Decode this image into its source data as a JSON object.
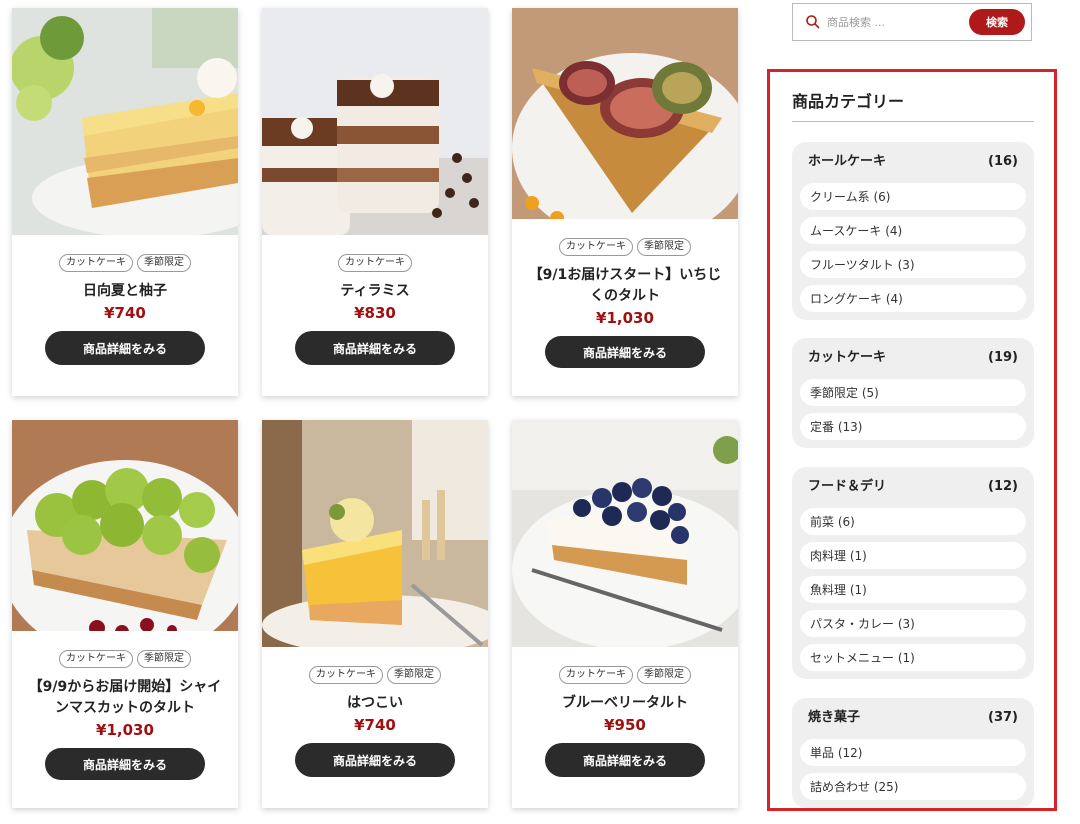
{
  "products": [
    {
      "name": "日向夏と柚子",
      "price": "¥740",
      "tags": [
        "カットケーキ",
        "季節限定"
      ],
      "button": "商品詳細をみる",
      "image": "yuzu-cake-photo"
    },
    {
      "name": "ティラミス",
      "price": "¥830",
      "tags": [
        "カットケーキ"
      ],
      "button": "商品詳細をみる",
      "image": "tiramisu-photo"
    },
    {
      "name": "【9/1お届けスタート】いちじくのタルト",
      "price": "¥1,030",
      "tags": [
        "カットケーキ",
        "季節限定"
      ],
      "button": "商品詳細をみる",
      "image": "fig-tart-photo"
    },
    {
      "name": "【9/9からお届け開始】シャインマスカットのタルト",
      "price": "¥1,030",
      "tags": [
        "カットケーキ",
        "季節限定"
      ],
      "button": "商品詳細をみる",
      "image": "muscat-tart-photo"
    },
    {
      "name": "はつこい",
      "price": "¥740",
      "tags": [
        "カットケーキ",
        "季節限定"
      ],
      "button": "商品詳細をみる",
      "image": "hatsukoi-cake-photo"
    },
    {
      "name": "ブルーベリータルト",
      "price": "¥950",
      "tags": [
        "カットケーキ",
        "季節限定"
      ],
      "button": "商品詳細をみる",
      "image": "blueberry-tart-photo"
    }
  ],
  "search": {
    "placeholder": "商品検索 ...",
    "button": "検索",
    "icon": "search-icon"
  },
  "categories": {
    "title": "商品カテゴリー",
    "groups": [
      {
        "name": "ホールケーキ",
        "count": "(16)",
        "items": [
          "クリーム系 (6)",
          "ムースケーキ (4)",
          "フルーツタルト (3)",
          "ロングケーキ (4)"
        ]
      },
      {
        "name": "カットケーキ",
        "count": "(19)",
        "items": [
          "季節限定 (5)",
          "定番 (13)"
        ]
      },
      {
        "name": "フード＆デリ",
        "count": "(12)",
        "items": [
          "前菜 (6)",
          "肉料理 (1)",
          "魚料理 (1)",
          "パスタ・カレー (3)",
          "セットメニュー (1)"
        ]
      },
      {
        "name": "焼き菓子",
        "count": "(37)",
        "items": [
          "単品 (12)",
          "詰め合わせ (25)"
        ]
      }
    ]
  },
  "colors": {
    "accent": "#b01919",
    "highlight_border": "#d6232a",
    "button_dark": "#2b2b2b",
    "price": "#a01010"
  }
}
